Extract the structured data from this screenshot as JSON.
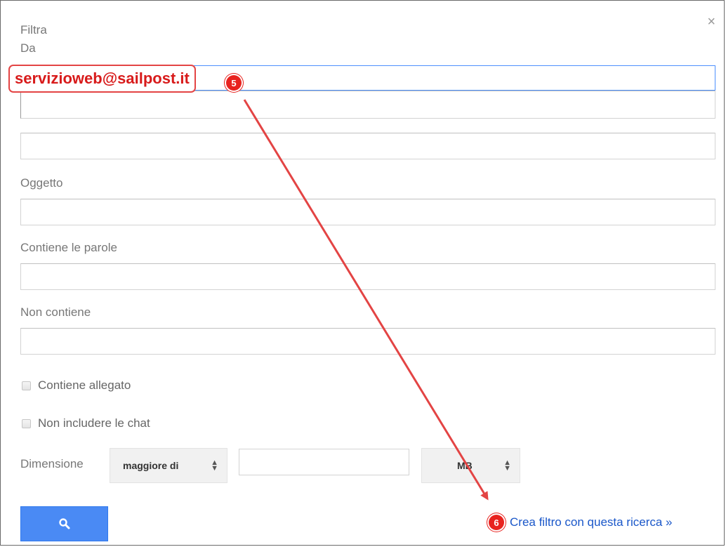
{
  "dialog": {
    "title": "Filtra",
    "close_glyph": "×"
  },
  "fields": {
    "from_label": "Da",
    "from_value": "",
    "to_value": "",
    "subject_label": "Oggetto",
    "subject_value": "",
    "has_words_label": "Contiene le parole",
    "has_words_value": "",
    "no_words_label": "Non contiene",
    "no_words_value": ""
  },
  "checkboxes": {
    "has_attachment": {
      "label": "Contiene allegato",
      "checked": false
    },
    "exclude_chats": {
      "label": "Non includere le chat",
      "checked": false
    }
  },
  "size": {
    "label": "Dimensione",
    "operator": "maggiore di",
    "value": "",
    "unit": "MB"
  },
  "actions": {
    "search_icon": "search-icon",
    "create_filter_label": "Crea filtro con questa ricerca »"
  },
  "annotations": {
    "callout_text": "servizioweb@sailpost.it",
    "step_a": "5",
    "step_b": "6",
    "color": "#e8231f"
  }
}
